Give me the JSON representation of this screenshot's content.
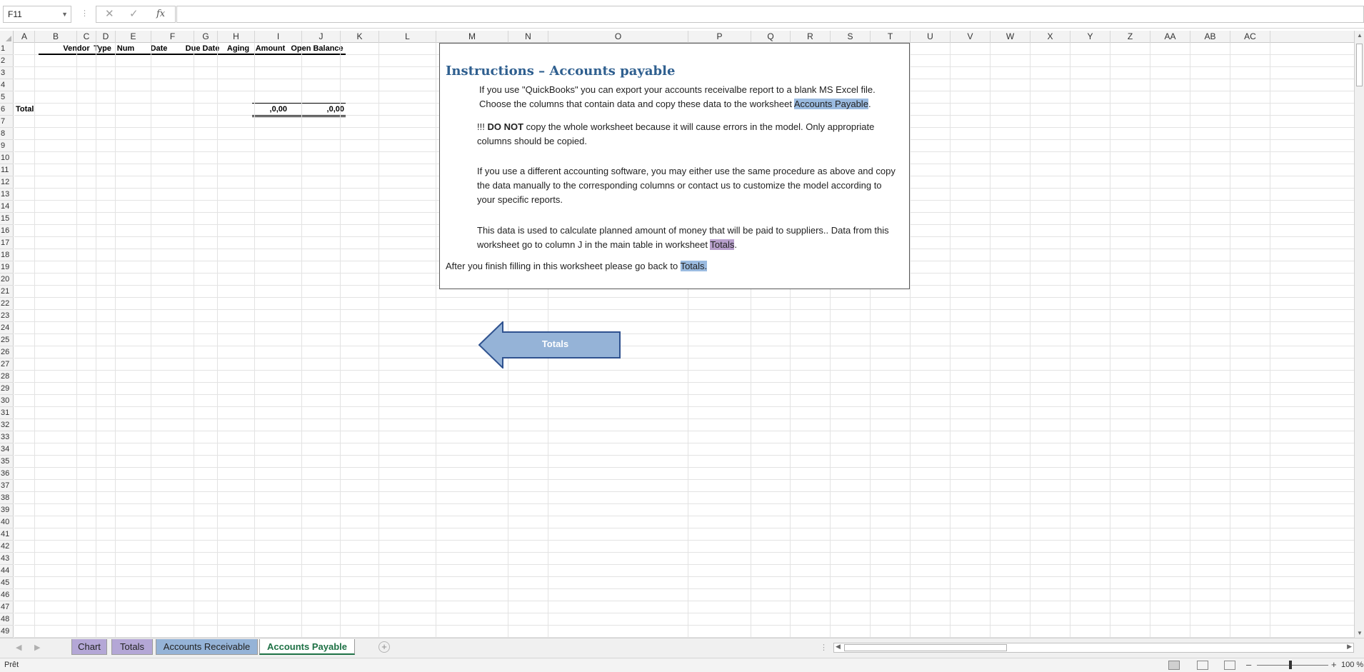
{
  "formula_bar": {
    "name_box": "F11",
    "cancel_icon": "✕",
    "enter_icon": "✓",
    "fx_label": "fx",
    "formula": ""
  },
  "columns": [
    "A",
    "B",
    "C",
    "D",
    "E",
    "F",
    "G",
    "H",
    "I",
    "J",
    "K",
    "L",
    "M",
    "N",
    "O",
    "P",
    "Q",
    "R",
    "S",
    "T",
    "U",
    "V",
    "W",
    "X",
    "Y",
    "Z",
    "AA",
    "AB",
    "AC"
  ],
  "rows": [
    "1",
    "2",
    "3",
    "4",
    "5",
    "6",
    "7",
    "8",
    "9",
    "10",
    "11",
    "12",
    "13",
    "14",
    "15",
    "16",
    "17",
    "18",
    "19",
    "20",
    "21",
    "22",
    "23",
    "24",
    "25",
    "26",
    "27",
    "28",
    "29",
    "30",
    "31",
    "32",
    "33",
    "34",
    "35",
    "36",
    "37",
    "38",
    "39",
    "40",
    "41",
    "42",
    "43",
    "44",
    "45",
    "46",
    "47",
    "48",
    "49"
  ],
  "sheet": {
    "headers": {
      "vendor": "Vendor",
      "type": "Type",
      "num": "Num",
      "date": "Date",
      "due_date": "Due Date",
      "aging": "Aging",
      "amount": "Amount",
      "open_balance": "Open Balance"
    },
    "total_label": "Total",
    "total_amount": ",0,00",
    "total_open_balance": ",0,00"
  },
  "instructions": {
    "title": "Instructions – Accounts payable",
    "p1_a": "If you use \"QuickBooks\" you can export your accounts receivalbe report to a blank MS Excel file.",
    "p1_b": "Choose the columns that contain data and copy these data to the worksheet ",
    "p1_link": "Accounts Payable",
    "p1_end": ".",
    "p2_prefix": "!!! ",
    "p2_bold": "DO NOT",
    "p2_rest": " copy the whole worksheet because it will cause errors in the model. Only appropriate columns should be copied.",
    "p3": "If you use a different accounting software, you may either use the same procedure as above and copy the data manually to the corresponding columns or contact us to customize the model according to your specific reports.",
    "p4_a": "This data is used to calculate planned amount of money that will be paid to suppliers.. Data from this worksheet go to column J in the main table in worksheet ",
    "p4_link": "Totals",
    "p4_end": ".",
    "last_a": "After you finish filling in this worksheet please go back to ",
    "last_link": "Totals."
  },
  "arrow_button": {
    "label": "Totals",
    "fill": "#95b3d7",
    "stroke": "#2f528f"
  },
  "tabs": [
    {
      "label": "Chart",
      "color": "#b4a7d6"
    },
    {
      "label": "Totals",
      "color": "#b4a7d6"
    },
    {
      "label": "Accounts Receivable",
      "color": "#95b3d7"
    },
    {
      "label": "Accounts Payable",
      "color": "#ffffff"
    }
  ],
  "active_tab_color": "#1e7145",
  "status": {
    "text": "Prêt",
    "zoom": "100 %"
  }
}
